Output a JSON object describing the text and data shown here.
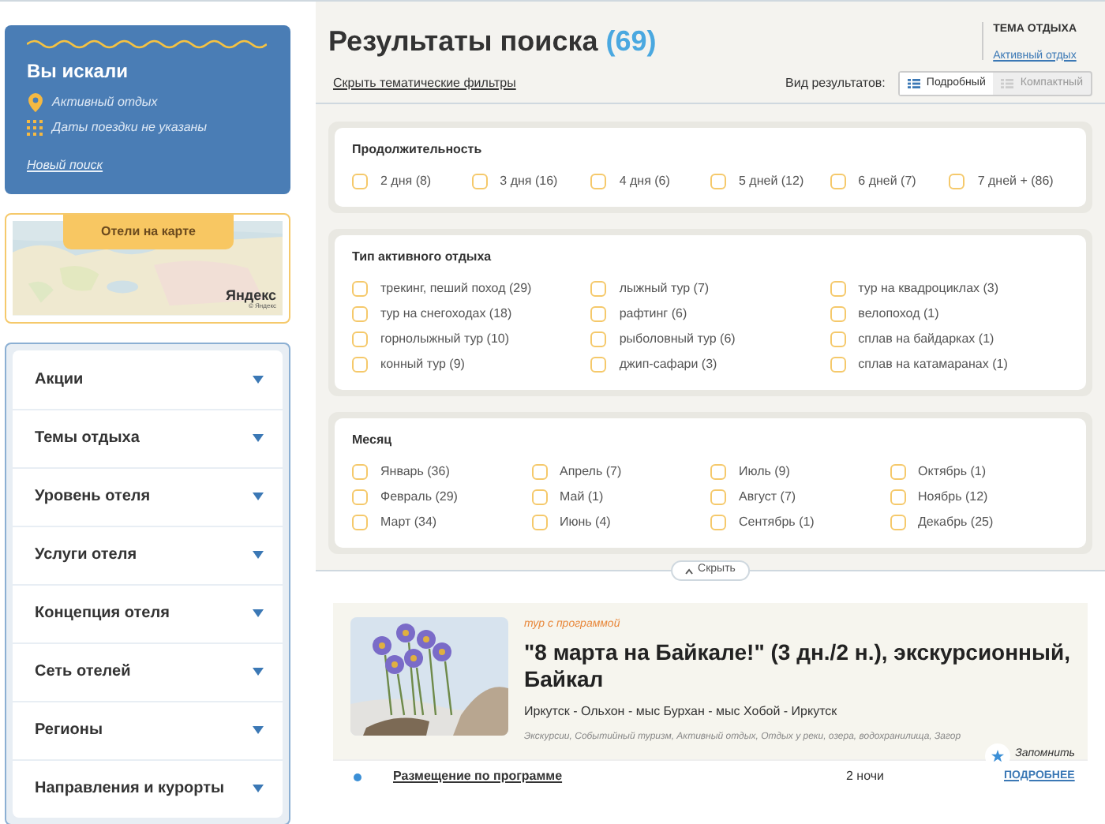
{
  "search_summary": {
    "title": "Вы искали",
    "items": [
      {
        "kind": "place",
        "text": "Активный отдых"
      },
      {
        "kind": "dates",
        "text": "Даты поездки не указаны"
      }
    ],
    "new_search": "Новый поиск"
  },
  "map": {
    "button": "Отели на карте",
    "logo": "Яндекс",
    "copyright": "© Яндекс"
  },
  "sidebar": {
    "items": [
      {
        "label": "Акции",
        "expanded": false
      },
      {
        "label": "Темы отдыха",
        "expanded": false
      },
      {
        "label": "Уровень отеля",
        "expanded": false
      },
      {
        "label": "Услуги отеля",
        "expanded": false
      },
      {
        "label": "Концепция отеля",
        "expanded": false
      },
      {
        "label": "Сеть отелей",
        "expanded": false
      },
      {
        "label": "Регионы",
        "expanded": false
      },
      {
        "label": "Направления и курорты",
        "expanded": false
      }
    ]
  },
  "header": {
    "title": "Результаты поиска",
    "count": "(69)",
    "theme_label": "ТЕМА ОТДЫХА",
    "theme_value": "Активный отдых",
    "hide_filters": "Скрыть тематические фильтры",
    "view_label": "Вид результатов:",
    "views": [
      {
        "label": "Подробный",
        "selected": true
      },
      {
        "label": "Компактный",
        "selected": false
      }
    ]
  },
  "filters": [
    {
      "title": "Продолжительность",
      "options": [
        {
          "label": "2 дня (8)",
          "checked": false
        },
        {
          "label": "3 дня (16)",
          "checked": false
        },
        {
          "label": "4 дня (6)",
          "checked": false
        },
        {
          "label": "5 дней (12)",
          "checked": false
        },
        {
          "label": "6 дней (7)",
          "checked": false
        },
        {
          "label": "7 дней + (86)",
          "checked": false
        }
      ]
    },
    {
      "title": "Тип активного отдыха",
      "options": [
        {
          "label": "трекинг, пеший поход (29)",
          "checked": false
        },
        {
          "label": "лыжный тур (7)",
          "checked": false
        },
        {
          "label": "тур на квадроциклах (3)",
          "checked": false
        },
        {
          "label": "тур на снегоходах (18)",
          "checked": false
        },
        {
          "label": "рафтинг (6)",
          "checked": false
        },
        {
          "label": "велопоход (1)",
          "checked": false
        },
        {
          "label": "горнолыжный тур (10)",
          "checked": false
        },
        {
          "label": "рыболовный тур (6)",
          "checked": false
        },
        {
          "label": "сплав на байдарках (1)",
          "checked": false
        },
        {
          "label": "конный тур (9)",
          "checked": false
        },
        {
          "label": "джип-сафари (3)",
          "checked": false
        },
        {
          "label": "сплав на катамаранах (1)",
          "checked": false
        }
      ]
    },
    {
      "title": "Месяц",
      "options": [
        {
          "label": "Январь (36)",
          "checked": false
        },
        {
          "label": "Апрель (7)",
          "checked": false
        },
        {
          "label": "Июль (9)",
          "checked": false
        },
        {
          "label": "Октябрь (1)",
          "checked": false
        },
        {
          "label": "Февраль (29)",
          "checked": false
        },
        {
          "label": "Май (1)",
          "checked": false
        },
        {
          "label": "Август (7)",
          "checked": false
        },
        {
          "label": "Ноябрь (12)",
          "checked": false
        },
        {
          "label": "Март (34)",
          "checked": false
        },
        {
          "label": "Июнь (4)",
          "checked": false
        },
        {
          "label": "Сентябрь (1)",
          "checked": false
        },
        {
          "label": "Декабрь (25)",
          "checked": false
        }
      ]
    }
  ],
  "hide_button": "Скрыть",
  "result": {
    "type": "тур с программой",
    "title": "\"8 марта на Байкале!\" (3 дн./2 н.), экскурсионный, Байкал",
    "route": "Иркутск - Ольхон - мыс Бурхан - мыс Хобой - Иркутск",
    "tags": "Экскурсии, Событийный туризм, Активный отдых, Отдых у реки, озера, водохранилища, Загор",
    "remember": "Запомнить",
    "row": {
      "name": "Размещение по программе",
      "nights": "2 ночи",
      "more": "ПОДРОБНЕЕ"
    }
  }
}
